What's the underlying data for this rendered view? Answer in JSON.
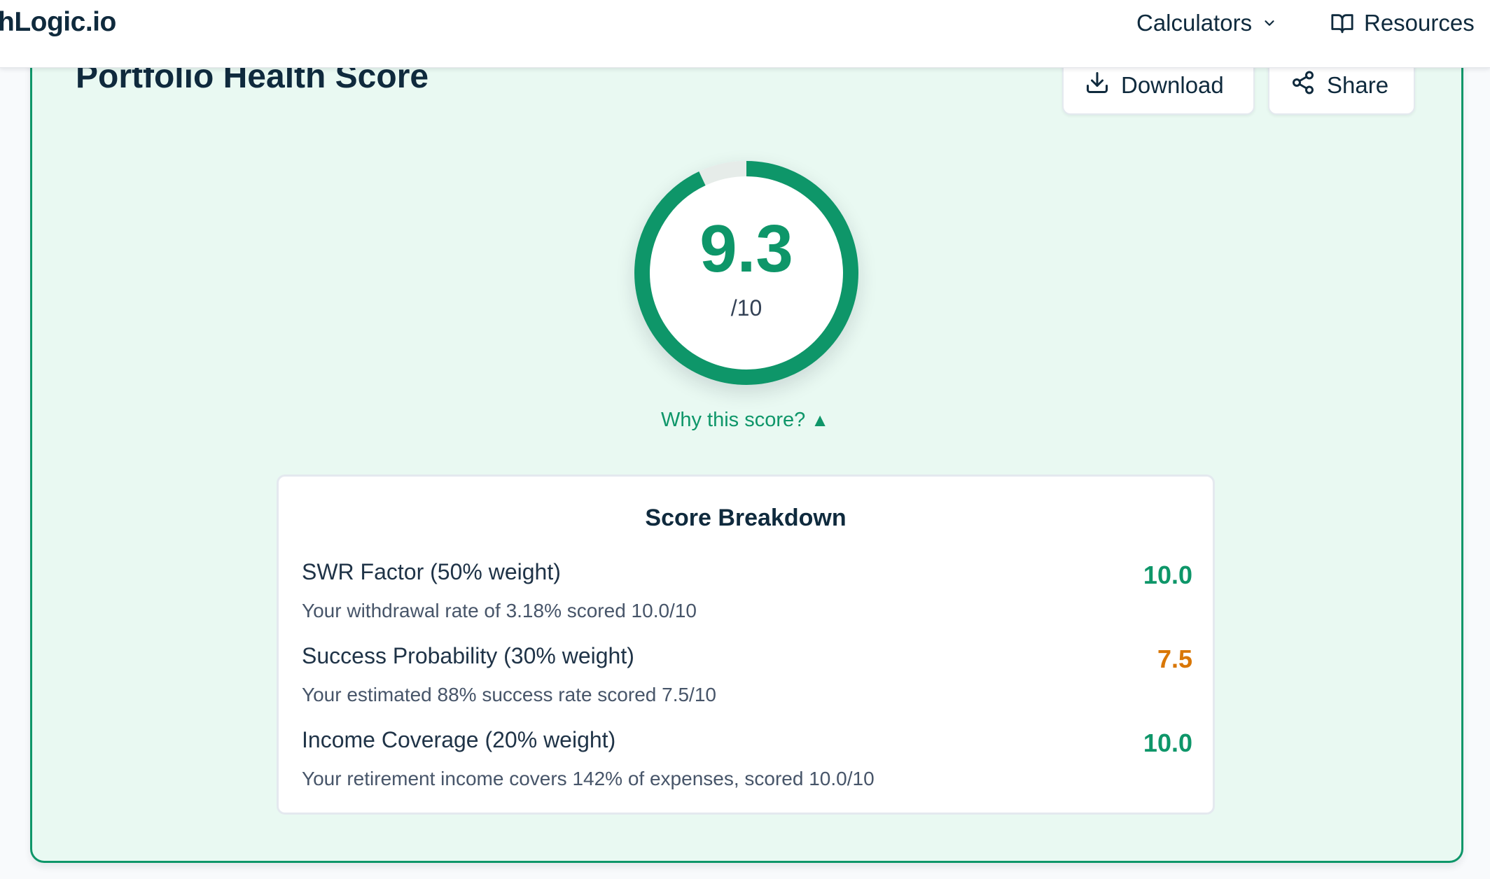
{
  "nav": {
    "brand": "hLogic.io",
    "calculators_label": "Calculators",
    "resources_label": "Resources"
  },
  "card": {
    "title": "Portfolio Health Score",
    "download_label": "Download",
    "share_label": "Share"
  },
  "score": {
    "value": "9.3",
    "max": "/10",
    "fraction": 0.93,
    "ring_color": "#0e9669",
    "why_label": "Why this score?",
    "why_caret": "▲"
  },
  "breakdown": {
    "title": "Score Breakdown",
    "factors": [
      {
        "label": "SWR Factor (50% weight)",
        "description": "Your withdrawal rate of 3.18% scored 10.0/10",
        "score": "10.0",
        "color": "#0e9669"
      },
      {
        "label": "Success Probability (30% weight)",
        "description": "Your estimated 88% success rate scored 7.5/10",
        "score": "7.5",
        "color": "#d97706"
      },
      {
        "label": "Income Coverage (20% weight)",
        "description": "Your retirement income covers 142% of expenses, scored 10.0/10",
        "score": "10.0",
        "color": "#0e9669"
      }
    ]
  },
  "colors": {
    "accent": "#0e9669",
    "warning": "#d97706",
    "card_background": "#e9f9f2",
    "text_primary": "#0f2a3d"
  },
  "icons": {
    "calculators_chevron": "chevron-down-icon",
    "resources": "book-open-icon",
    "download": "download-icon",
    "share": "share-icon"
  }
}
